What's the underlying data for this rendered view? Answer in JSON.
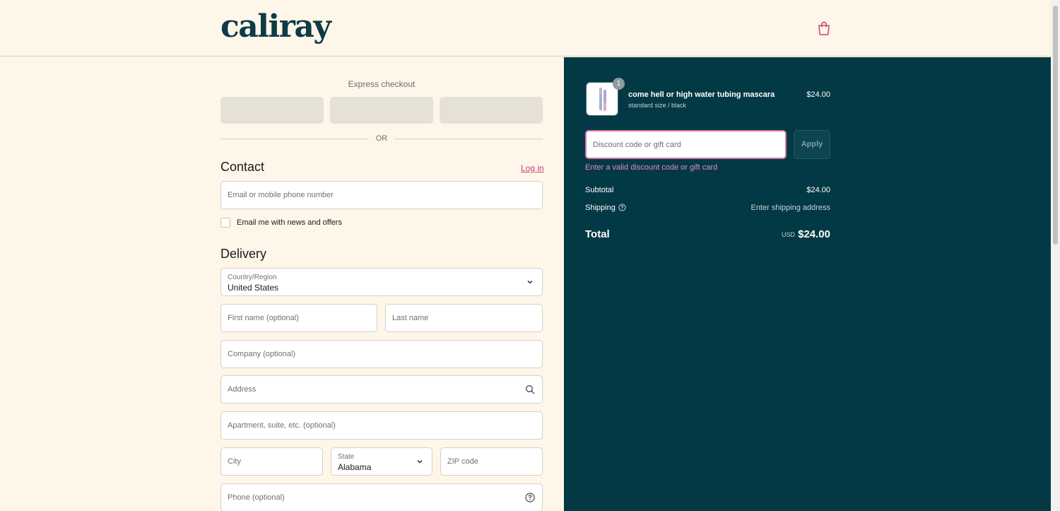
{
  "brand": {
    "logo_text": "caliray",
    "accent_color": "#c0437a",
    "panel_color": "#033944"
  },
  "header": {
    "cart_icon": "shopping-bag-icon"
  },
  "express": {
    "label": "Express checkout",
    "divider": "OR"
  },
  "contact": {
    "title": "Contact",
    "login_link": "Log in",
    "email_placeholder": "Email or mobile phone number",
    "newsletter_label": "Email me with news and offers",
    "newsletter_checked": false
  },
  "delivery": {
    "title": "Delivery",
    "country_label": "Country/Region",
    "country_value": "United States",
    "first_name_placeholder": "First name (optional)",
    "last_name_placeholder": "Last name",
    "company_placeholder": "Company (optional)",
    "address_placeholder": "Address",
    "apartment_placeholder": "Apartment, suite, etc. (optional)",
    "city_placeholder": "City",
    "state_label": "State",
    "state_value": "Alabama",
    "zip_placeholder": "ZIP code",
    "phone_placeholder": "Phone (optional)"
  },
  "order": {
    "item": {
      "name": "come hell or high water tubing mascara",
      "variant": "standard size / black",
      "price": "$24.00",
      "quantity": "1"
    },
    "discount_placeholder": "Discount code or gift card",
    "apply_label": "Apply",
    "error": "Enter a valid discount code or gift card",
    "subtotal_label": "Subtotal",
    "subtotal_value": "$24.00",
    "shipping_label": "Shipping",
    "shipping_value": "Enter shipping address",
    "total_label": "Total",
    "currency": "USD",
    "total_value": "$24.00"
  }
}
